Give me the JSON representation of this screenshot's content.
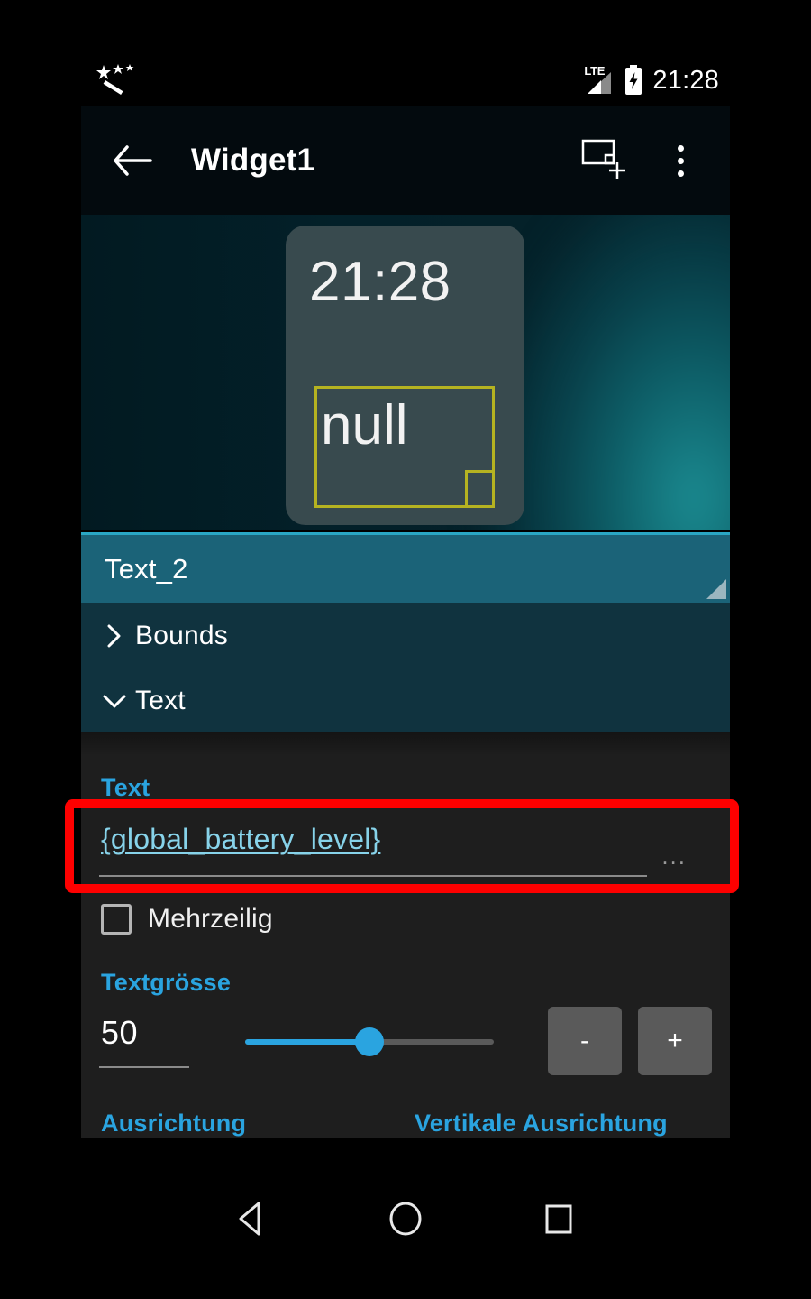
{
  "status_bar": {
    "notification_icon": "magic-wand-icon",
    "network_type": "LTE",
    "battery_icon": "battery-charging-icon",
    "clock": "21:28"
  },
  "app_bar": {
    "back_icon": "back-arrow-icon",
    "title": "Widget1",
    "add_widget_icon": "add-widget-icon",
    "overflow_icon": "overflow-menu-icon"
  },
  "preview": {
    "widget_clock": "21:28",
    "selected_element_text": "null",
    "selection_color": "#b5b321",
    "card_color": "#384a4e"
  },
  "layer_bar": {
    "label": "Text_2",
    "background": "#1b6378",
    "accent": "#2aa7c4"
  },
  "sections": [
    {
      "label": "Bounds",
      "icon": "chevron-right-icon",
      "expanded": false
    },
    {
      "label": "Text",
      "icon": "chevron-down-icon",
      "expanded": true
    }
  ],
  "text_section": {
    "text_label": "Text",
    "text_value": "{global_battery_level}",
    "more_button": "...",
    "multiline_label": "Mehrzeilig",
    "multiline_checked": false,
    "textsize_label": "Textgrösse",
    "textsize_value": "50",
    "textsize_percent": 50,
    "minus_label": "-",
    "plus_label": "+",
    "alignment_label": "Ausrichtung",
    "vertical_alignment_label": "Vertikale Ausrichtung",
    "label_color": "#2aa4e0",
    "value_color": "#87d3ea"
  },
  "highlight": {
    "color": "#fe0000",
    "target": "text-value-field"
  },
  "nav_bar": {
    "back": "nav-back-icon",
    "home": "nav-home-icon",
    "recents": "nav-recents-icon"
  }
}
